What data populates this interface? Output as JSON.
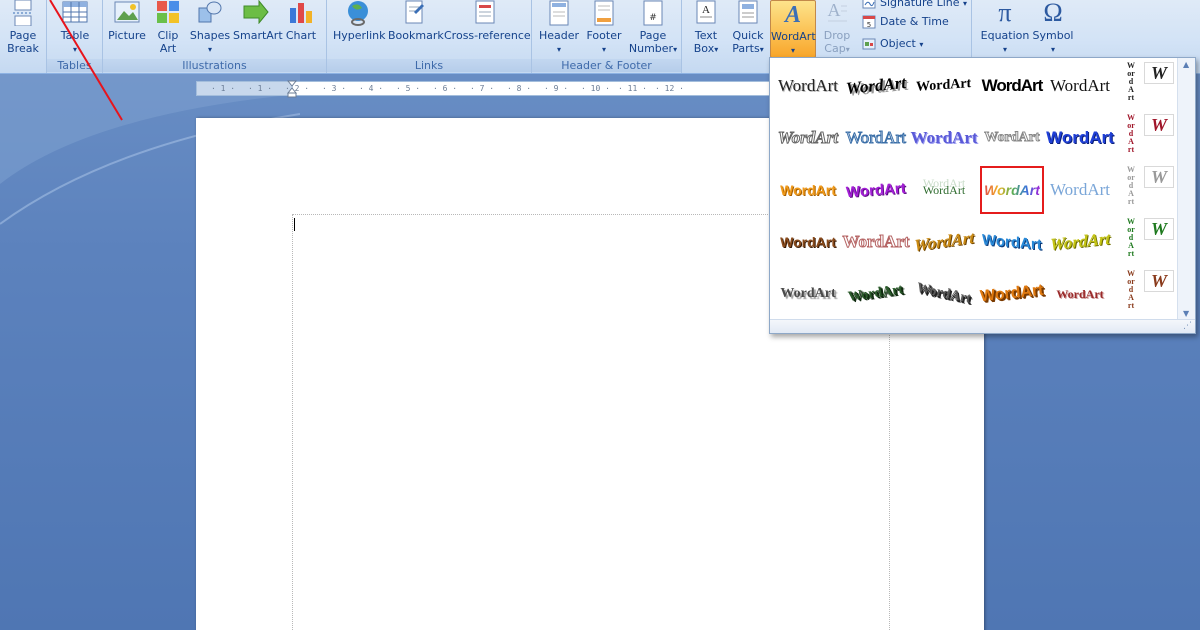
{
  "ribbon": {
    "pages": {
      "break_label_1": "Page",
      "break_label_2": "Break"
    },
    "tables": {
      "table_label": "Table",
      "group_label": "Tables"
    },
    "illustrations": {
      "picture": "Picture",
      "clipart_1": "Clip",
      "clipart_2": "Art",
      "shapes": "Shapes",
      "smartart": "SmartArt",
      "chart": "Chart",
      "group_label": "Illustrations"
    },
    "links": {
      "hyperlink": "Hyperlink",
      "bookmark": "Bookmark",
      "crossref": "Cross-reference",
      "group_label": "Links"
    },
    "header_footer": {
      "header": "Header",
      "footer": "Footer",
      "page_number_1": "Page",
      "page_number_2": "Number",
      "group_label": "Header & Footer"
    },
    "text": {
      "textbox_1": "Text",
      "textbox_2": "Box",
      "quickparts_1": "Quick",
      "quickparts_2": "Parts",
      "wordart": "WordArt",
      "dropcap_1": "Drop",
      "dropcap_2": "Cap",
      "signature_line": "Signature Line",
      "date_time": "Date & Time",
      "object": "Object"
    },
    "symbols": {
      "equation": "Equation",
      "symbol": "Symbol"
    }
  },
  "ruler": {
    "labels": [
      "1",
      "1",
      "2",
      "3",
      "4",
      "5",
      "6",
      "7",
      "8",
      "9",
      "10",
      "11",
      "12"
    ]
  },
  "gallery": {
    "sample_text": "WordArt",
    "vertical_text": "WordArt",
    "w_text": "W",
    "selected_index": 13,
    "styles": [
      {
        "color": "#222222",
        "style": "plain"
      },
      {
        "color": "#000000",
        "style": "arc-shadow"
      },
      {
        "color": "#000000",
        "style": "wave"
      },
      {
        "color": "#000000",
        "style": "bold-heavy"
      },
      {
        "color": "#111111",
        "style": "serif"
      },
      {
        "color": "#6f6f6f",
        "style": "outline-italic"
      },
      {
        "color": "#3b6fa8",
        "style": "outline"
      },
      {
        "color": "#5a5ad8",
        "style": "gradient"
      },
      {
        "color": "#8c8c8c",
        "style": "outline-gray"
      },
      {
        "color": "#1f3fd6",
        "style": "blue-heavy"
      },
      {
        "color": "#f09a1a",
        "style": "gold"
      },
      {
        "color": "#a31fd6",
        "style": "purple"
      },
      {
        "color": "#2e6b2e",
        "style": "green-stack"
      },
      {
        "color": "#7a5bd4",
        "style": "rainbow"
      },
      {
        "color": "#7aa6d8",
        "style": "light-blue"
      },
      {
        "color": "#8a4b1c",
        "style": "wood"
      },
      {
        "color": "#b56464",
        "style": "outline-brown"
      },
      {
        "color": "#c98a14",
        "style": "amber-slant"
      },
      {
        "color": "#2a8ad8",
        "style": "blue-wave"
      },
      {
        "color": "#c4c414",
        "style": "yellow-slant"
      },
      {
        "color": "#4a4a4a",
        "style": "gray-shadow"
      },
      {
        "color": "#2a5a2a",
        "style": "green-3d"
      },
      {
        "color": "#5a5a5a",
        "style": "stone-3d"
      },
      {
        "color": "#e07a10",
        "style": "orange-3d"
      },
      {
        "color": "#9a2a2a",
        "style": "red-shadow"
      }
    ],
    "side_styles": [
      {
        "color": "#222222"
      },
      {
        "color": "#a0162a"
      },
      {
        "color": "#999999"
      },
      {
        "color": "#1f7a1f"
      },
      {
        "color": "#8a3b1c"
      }
    ]
  },
  "colors": {
    "selection_outline": "#e51c1c",
    "annotation_arrow": "#e8141c",
    "app_background": "#5c82bd"
  }
}
